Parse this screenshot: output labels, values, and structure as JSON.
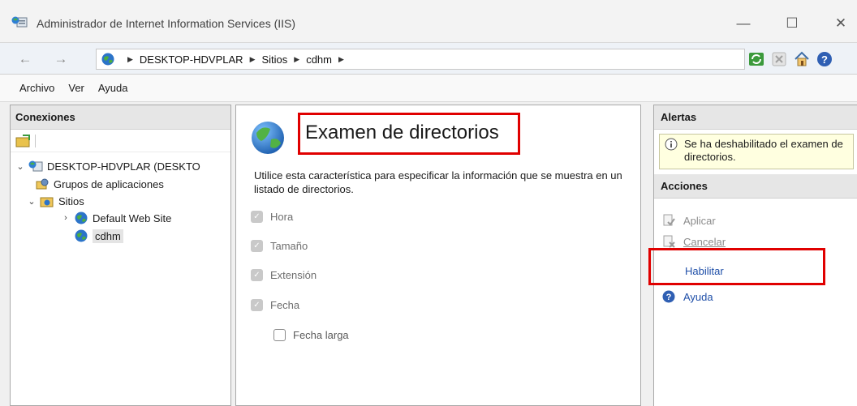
{
  "window": {
    "title": "Administrador de Internet Information Services (IIS)",
    "controls": {
      "minimize": "—",
      "maximize": "☐",
      "close": "✕"
    }
  },
  "address": {
    "back": "←",
    "forward": "→",
    "crumbs": [
      "DESKTOP-HDVPLAR",
      "Sitios",
      "cdhm"
    ],
    "separator": "▶"
  },
  "menu": {
    "items": [
      "Archivo",
      "Ver",
      "Ayuda"
    ]
  },
  "connections": {
    "header": "Conexiones",
    "tree": {
      "server": "DESKTOP-HDVPLAR (DESKTO",
      "app_pools": "Grupos de aplicaciones",
      "sites": "Sitios",
      "default_site": "Default Web Site",
      "selected_site": "cdhm"
    }
  },
  "feature": {
    "title": "Examen de directorios",
    "description": "Utilice esta característica para especificar la información que se muestra en un listado de directorios.",
    "options": [
      {
        "label": "Hora",
        "checked": true
      },
      {
        "label": "Tamaño",
        "checked": true
      },
      {
        "label": "Extensión",
        "checked": true
      },
      {
        "label": "Fecha",
        "checked": true
      },
      {
        "label": "Fecha larga",
        "checked": false
      }
    ]
  },
  "alerts": {
    "header": "Alertas",
    "message": "Se ha deshabilitado el examen de directorios."
  },
  "actions": {
    "header": "Acciones",
    "apply": "Aplicar",
    "cancel": "Cancelar",
    "enable": "Habilitar",
    "help": "Ayuda"
  },
  "colors": {
    "highlight": "#e00000",
    "link": "#1f4fa8",
    "alert_background": "#ffffe0"
  }
}
